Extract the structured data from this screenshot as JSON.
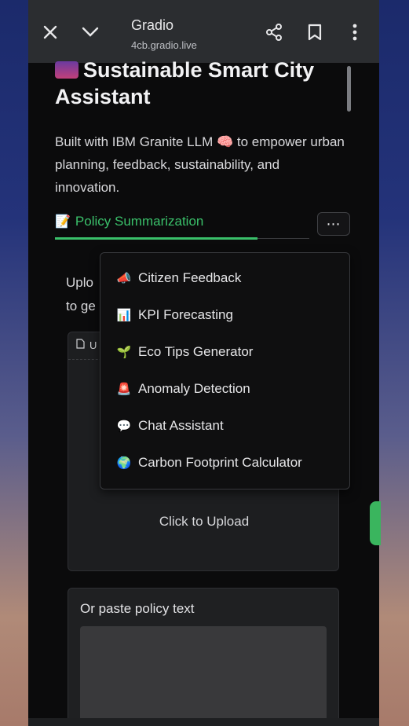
{
  "browser": {
    "title": "Gradio",
    "url": "4cb.gradio.live"
  },
  "page": {
    "heading": "Sustainable Smart City Assistant",
    "description": "Built with IBM Granite LLM 🧠 to empower urban planning, feedback, sustainability, and innovation."
  },
  "tabs": {
    "active_label": "Policy Summarization",
    "more_label": "⋯"
  },
  "upload": {
    "instruction_partial_1": "Uplo",
    "instruction_partial_2": "to ge",
    "label_partial": "U",
    "click_label": "Click to Upload"
  },
  "paste": {
    "label": "Or paste policy text"
  },
  "menu": {
    "items": [
      {
        "label": "Citizen Feedback",
        "icon": "megaphone-icon"
      },
      {
        "label": "KPI Forecasting",
        "icon": "bar-chart-icon"
      },
      {
        "label": "Eco Tips Generator",
        "icon": "seedling-icon"
      },
      {
        "label": "Anomaly Detection",
        "icon": "siren-icon"
      },
      {
        "label": "Chat Assistant",
        "icon": "speech-bubble-icon"
      },
      {
        "label": "Carbon Footprint Calculator",
        "icon": "globe-icon"
      }
    ]
  },
  "colors": {
    "accent": "#3ac06a",
    "panel": "#0b0b0c",
    "browser_bar": "#2b2d30"
  }
}
